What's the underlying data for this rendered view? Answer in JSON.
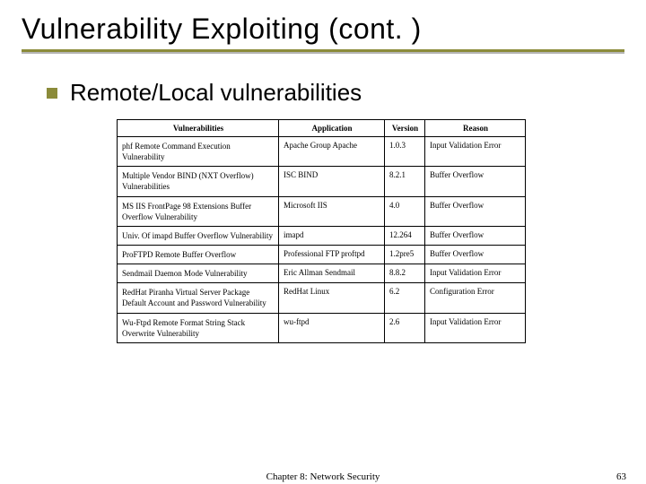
{
  "title": "Vulnerability Exploiting (cont. )",
  "bullet": "Remote/Local vulnerabilities",
  "headers": {
    "vuln": "Vulnerabilities",
    "app": "Application",
    "ver": "Version",
    "rea": "Reason"
  },
  "rows": [
    {
      "vuln": "phf Remote Command Execution Vulnerability",
      "app": "Apache Group Apache",
      "ver": "1.0.3",
      "rea": "Input Validation Error"
    },
    {
      "vuln": "Multiple Vendor BIND (NXT Overflow) Vulnerabilities",
      "app": "ISC BIND",
      "ver": "8.2.1",
      "rea": "Buffer Overflow"
    },
    {
      "vuln": "MS IIS FrontPage 98 Extensions Buffer Overflow Vulnerability",
      "app": "Microsoft IIS",
      "ver": "4.0",
      "rea": "Buffer Overflow"
    },
    {
      "vuln": "Univ. Of imapd Buffer Overflow Vulnerability",
      "app": "imapd",
      "ver": "12.264",
      "rea": "Buffer Overflow"
    },
    {
      "vuln": "ProFTPD Remote Buffer Overflow",
      "app": "Professional FTP proftpd",
      "ver": "1.2pre5",
      "rea": "Buffer Overflow"
    },
    {
      "vuln": "Sendmail Daemon Mode Vulnerability",
      "app": "Eric Allman Sendmail",
      "ver": "8.8.2",
      "rea": "Input Validation Error"
    },
    {
      "vuln": "RedHat Piranha Virtual Server Package Default Account and Password Vulnerability",
      "app": "RedHat Linux",
      "ver": "6.2",
      "rea": "Configuration Error"
    },
    {
      "vuln": "Wu-Ftpd Remote Format String Stack Overwrite Vulnerability",
      "app": "wu-ftpd",
      "ver": "2.6",
      "rea": "Input Validation Error"
    }
  ],
  "footer": {
    "center": "Chapter 8: Network Security",
    "right": "63"
  }
}
